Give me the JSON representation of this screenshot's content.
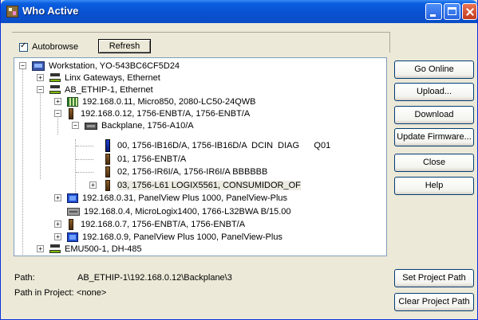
{
  "window": {
    "title": "Who Active"
  },
  "toolbar": {
    "autobrowse_label": "Autobrowse",
    "autobrowse_checked": true,
    "refresh_label": "Refresh"
  },
  "tree": {
    "workstation": "Workstation, YO-543BC6CF5D24",
    "linx": "Linx Gateways, Ethernet",
    "ab_ethip": "AB_ETHIP-1, Ethernet",
    "n11": "192.168.0.11, Micro850, 2080-LC50-24QWB",
    "n12": "192.168.0.12, 1756-ENBT/A, 1756-ENBT/A",
    "backplane": "Backplane, 1756-A10/A",
    "slot00": "00, 1756-IB16D/A, 1756-IB16D/A  DCIN  DIAG      Q01",
    "slot01": "01, 1756-ENBT/A",
    "slot02": "02, 1756-IR6I/A, 1756-IR6I/A BBBBBB",
    "slot03": "03, 1756-L61 LOGIX5561, CONSUMIDOR_OF",
    "n31": "192.168.0.31, PanelView Plus 1000, PanelView-Plus",
    "n4": "192.168.0.4, MicroLogix1400, 1766-L32BWA B/15.00",
    "n7": "192.168.0.7, 1756-ENBT/A, 1756-ENBT/A",
    "n9": "192.168.0.9, PanelView Plus 1000, PanelView-Plus",
    "emu": "EMU500-1, DH-485"
  },
  "buttons": {
    "go_online": "Go Online",
    "upload": "Upload...",
    "download": "Download",
    "update_firmware": "Update Firmware...",
    "close": "Close",
    "help": "Help",
    "set_project_path": "Set Project Path",
    "clear_project_path": "Clear Project Path"
  },
  "status": {
    "path_label": "Path:",
    "path_value": "AB_ETHIP-1\\192.168.0.12\\Backplane\\3",
    "project_label": "Path in Project:",
    "project_value": "<none>"
  },
  "colors": {
    "titlebar": "#0a5fe0",
    "window_bg": "#ece9d8",
    "selection": "#ecebe2"
  }
}
